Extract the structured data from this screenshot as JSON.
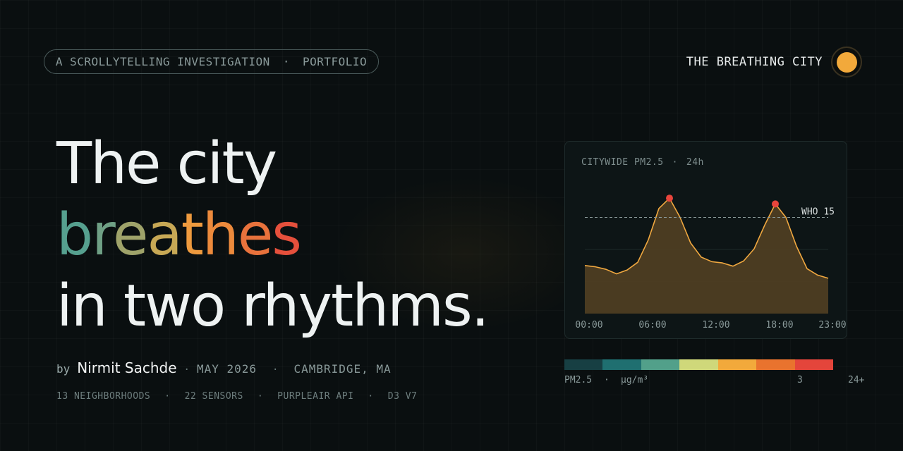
{
  "header": {
    "kicker_left": "A SCROLLYTELLING INVESTIGATION",
    "kicker_sep": "·",
    "kicker_right": "PORTFOLIO",
    "brand_name": "THE BREATHING CITY",
    "brand_dot_color": "#f2a93b"
  },
  "headline": {
    "line1": "The city",
    "line2_letters": [
      "b",
      "r",
      "e",
      "a",
      "t",
      "h",
      "e",
      "s"
    ],
    "line3": "in two rhythms."
  },
  "byline": {
    "by": "by",
    "author": "Nirmit Sachde",
    "sep": "·",
    "date": "MAY 2026",
    "location": "CAMBRIDGE, MA"
  },
  "stats": {
    "items": [
      "13 NEIGHBORHOODS",
      "22 SENSORS",
      "PURPLEAIR API",
      "D3 V7"
    ],
    "sep": "·"
  },
  "chart_data": {
    "type": "area",
    "title": "CITYWIDE PM2.5",
    "title_sep": "·",
    "subtitle": "24h",
    "x": [
      "00:00",
      "01:00",
      "02:00",
      "03:00",
      "04:00",
      "05:00",
      "06:00",
      "07:00",
      "08:00",
      "09:00",
      "10:00",
      "11:00",
      "12:00",
      "13:00",
      "14:00",
      "15:00",
      "16:00",
      "17:00",
      "18:00",
      "19:00",
      "20:00",
      "21:00",
      "22:00",
      "23:00"
    ],
    "y": [
      7.5,
      7.3,
      6.9,
      6.2,
      6.8,
      8.0,
      11.5,
      16.4,
      18.0,
      15.0,
      11.0,
      8.8,
      8.1,
      7.9,
      7.4,
      8.2,
      10.1,
      13.8,
      17.1,
      15.0,
      10.5,
      7.0,
      6.0,
      5.5
    ],
    "x_ticks": [
      "00:00",
      "06:00",
      "12:00",
      "18:00",
      "23:00"
    ],
    "peaks": [
      8,
      18
    ],
    "threshold": {
      "value": 15,
      "label": "WHO 15"
    },
    "ylim": [
      0,
      20
    ],
    "grid": true,
    "colors": {
      "line": "#f0a840",
      "fill": "#4e3d22",
      "peak": "#e8453c",
      "threshold": "#8a9a9a"
    }
  },
  "scale": {
    "colors": [
      "#173f43",
      "#1f6f70",
      "#52a08a",
      "#cfd87a",
      "#f2a93b",
      "#e9732e",
      "#e4453b"
    ],
    "label_left": "PM2.5",
    "label_sep": "·",
    "unit": "µg/m³",
    "label_mid": "3",
    "label_right": "24+"
  }
}
